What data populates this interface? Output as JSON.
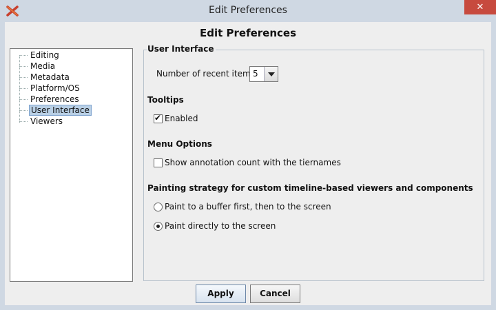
{
  "window": {
    "title": "Edit Preferences",
    "close_glyph": "✕",
    "app_icon": "x-logo-icon",
    "accent_close": "#c74a3e"
  },
  "dialog": {
    "title": "Edit Preferences"
  },
  "tree": {
    "items": [
      {
        "label": "Editing",
        "selected": false
      },
      {
        "label": "Media",
        "selected": false
      },
      {
        "label": "Metadata",
        "selected": false
      },
      {
        "label": "Platform/OS",
        "selected": false
      },
      {
        "label": "Preferences",
        "selected": false
      },
      {
        "label": "User Interface",
        "selected": true
      },
      {
        "label": "Viewers",
        "selected": false
      }
    ]
  },
  "panel": {
    "ui_section": {
      "title": "User Interface",
      "recent_label": "Number of recent items",
      "recent_value": "5"
    },
    "tooltips": {
      "title": "Tooltips",
      "enabled_label": "Enabled",
      "enabled_checked": true
    },
    "menu_options": {
      "title": "Menu Options",
      "show_count_label": "Show annotation count with the tiernames",
      "show_count_checked": false
    },
    "painting": {
      "title": "Painting strategy for custom timeline-based viewers and components",
      "option_buffer": "Paint to a buffer first, then to the screen",
      "option_direct": "Paint directly to the screen",
      "selected": "direct"
    }
  },
  "buttons": {
    "apply": "Apply",
    "cancel": "Cancel"
  }
}
